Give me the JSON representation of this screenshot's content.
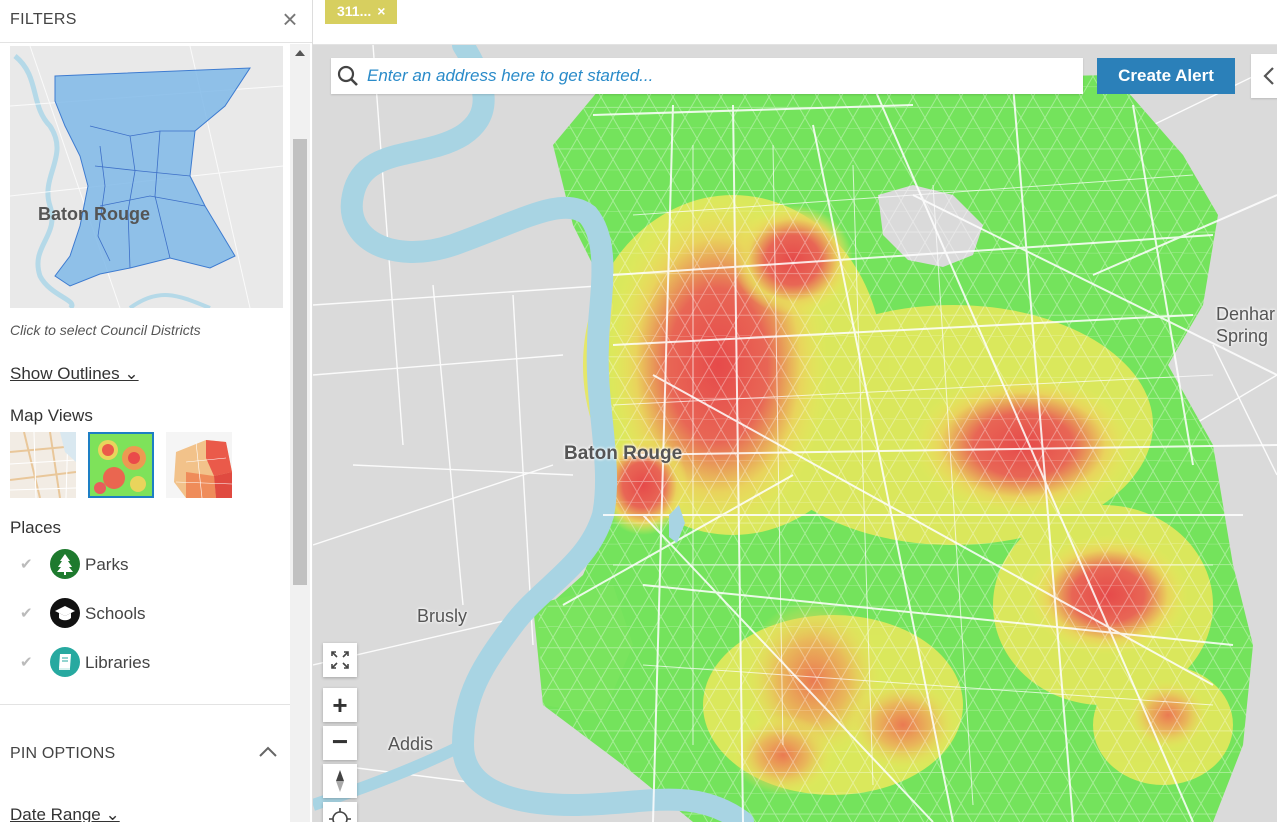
{
  "sidebar": {
    "title": "FILTERS",
    "close_label": "×",
    "district_map_label": "Baton Rouge",
    "district_caption": "Click to select Council Districts",
    "show_outlines": "Show Outlines ⌄",
    "map_views_title": "Map Views",
    "places_title": "Places",
    "places": [
      {
        "label": "Parks",
        "icon": "tree-icon",
        "color": "#1e7a2e"
      },
      {
        "label": "Schools",
        "icon": "graduation-cap-icon",
        "color": "#111111"
      },
      {
        "label": "Libraries",
        "icon": "book-icon",
        "color": "#27a9a0"
      }
    ],
    "pin_options_title": "PIN OPTIONS",
    "date_range": "Date Range ⌄"
  },
  "filter_chip": {
    "label": "311...",
    "close": "×",
    "color": "#d7cf5f"
  },
  "search": {
    "placeholder": "Enter an address here to get started..."
  },
  "create_alert": "Create Alert",
  "map": {
    "labels": {
      "baton_rouge": "Baton Rouge",
      "brusly": "Brusly",
      "addis": "Addis",
      "denham_1": "Denhar",
      "denham_2": "Spring"
    },
    "colors": {
      "low": "#6fe35a",
      "mid": "#e9e85c",
      "high": "#e85c5c",
      "water": "#a8d4e3"
    }
  }
}
